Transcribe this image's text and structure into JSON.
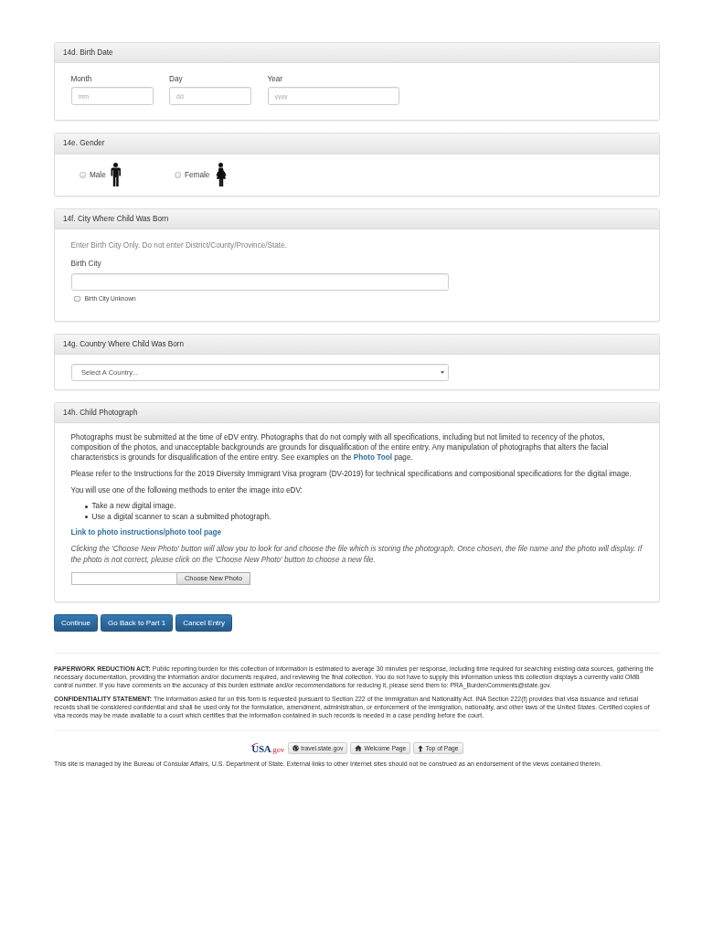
{
  "sections": [
    {
      "kind": "date",
      "heading": "14d. Birth Date",
      "fields": [
        {
          "label": "Month",
          "placeholder": "mm"
        },
        {
          "label": "Day",
          "placeholder": "dd"
        },
        {
          "label": "Year",
          "placeholder": "yyyy"
        }
      ]
    },
    {
      "kind": "gender",
      "heading": "14e. Gender",
      "options": [
        {
          "kind": "male",
          "label": "Male",
          "selected": false
        },
        {
          "kind": "female",
          "label": "Female",
          "selected": false
        }
      ]
    },
    {
      "kind": "city",
      "heading": "14f. City Where Child Was Born",
      "hint": "Enter Birth City Only. Do not enter District/County/Province/State.",
      "field_label": "Birth City",
      "checkbox": {
        "label": "Birth City Unknown",
        "checked": false
      }
    },
    {
      "kind": "country",
      "heading": "14g. Country Where Child Was Born",
      "select": {
        "value": "Select A Country..."
      }
    },
    {
      "kind": "photo",
      "heading": "14h. Child Photograph",
      "intro": {
        "text": "Photographs must be submitted at the time of eDV entry. Photographs that do not comply with all specifications, including but not limited to recency of the photos, composition of the photos, and unacceptable backgrounds are grounds for disqualification of the entire entry. Any manipulation of photographs that alters the facial characteristics is grounds for disqualification of the entire entry. See examples on the ",
        "link": "Photo Tool",
        "after": " page."
      },
      "paragraphs": [
        "Please refer to the Instructions for the 2019 Diversity Immigrant Visa program (DV-2019) for technical specifications and compositional specifications for the digital image.",
        "You will use one of the following methods to enter the image into eDV:"
      ],
      "methods": [
        "Take a new digital image.",
        "Use a digital scanner to scan a submitted photograph."
      ],
      "link": "Link to photo instructions/photo tool page",
      "note": "Clicking the 'Choose New Photo' button will allow you to look for and choose the file which is storing the photograph. Once chosen, the file name and the photo will display. If the photo is not correct, please click on the 'Choose New Photo' button to choose a new file.",
      "upload_button": "Choose New Photo"
    }
  ],
  "buttons": [
    "Continue",
    "Go Back to Part 1",
    "Cancel Entry"
  ],
  "notices": [
    "**PAPERWORK REDUCTION ACT:** Public reporting burden for this collection of information is estimated to average 30 minutes per response, including time required for searching existing data sources, gathering the necessary documentation, providing the information and/or documents required, and reviewing the final collection. You do not have to supply this information unless this collection displays a currently valid OMB control number. If you have comments on the accuracy of this burden estimate and/or recommendations for reducing it, please send them to: PRA_BurdenComments@state.gov.",
    "**CONFIDENTIALITY STATEMENT:** The information asked for on this form is requested pursuant to Section 222 of the Immigration and Nationality Act. INA Section 222(f) provides that visa issuance and refusal records shall be considered confidential and shall be used only for the formulation, amendment, administration, or enforcement of the immigration, nationality, and other laws of the United States. Certified copies of visa records may be made available to a court which certifies that the information contained in such records is needed in a case pending before the court."
  ],
  "footer": {
    "logo": {
      "name": "USA",
      "suffix": ".gov"
    },
    "links": [
      {
        "kind": "globe",
        "label": "travel.state.gov"
      },
      {
        "kind": "home",
        "label": "Welcome Page"
      },
      {
        "kind": "up",
        "label": "Top of Page"
      }
    ],
    "disclaimer": "This site is managed by the Bureau of Consular Affairs, U.S. Department of State. External links to other Internet sites should not be construed as an endorsement of the views contained therein."
  }
}
